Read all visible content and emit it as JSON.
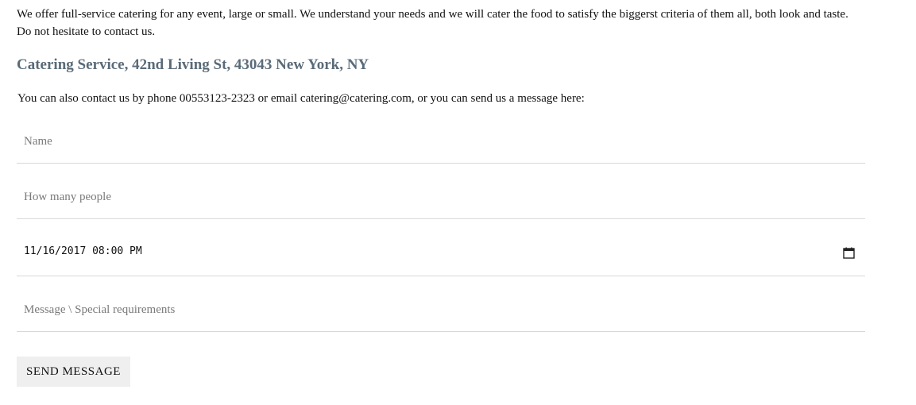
{
  "intro_text": "We offer full-service catering for any event, large or small. We understand your needs and we will cater the food to satisfy the biggerst criteria of them all, both look and taste. Do not hesitate to contact us.",
  "address_heading": "Catering Service, 42nd Living St, 43043 New York, NY",
  "contact_line": "You can also contact us by phone 00553123-2323 or email catering@catering.com, or you can send us a message here:",
  "form": {
    "name": {
      "placeholder": "Name",
      "value": ""
    },
    "people": {
      "placeholder": "How many people",
      "value": ""
    },
    "datetime": {
      "value": "11/16/2017 08:00 PM",
      "icon": "calendar-icon"
    },
    "message": {
      "placeholder": "Message \\ Special requirements",
      "value": ""
    },
    "submit_label": "SEND MESSAGE"
  }
}
